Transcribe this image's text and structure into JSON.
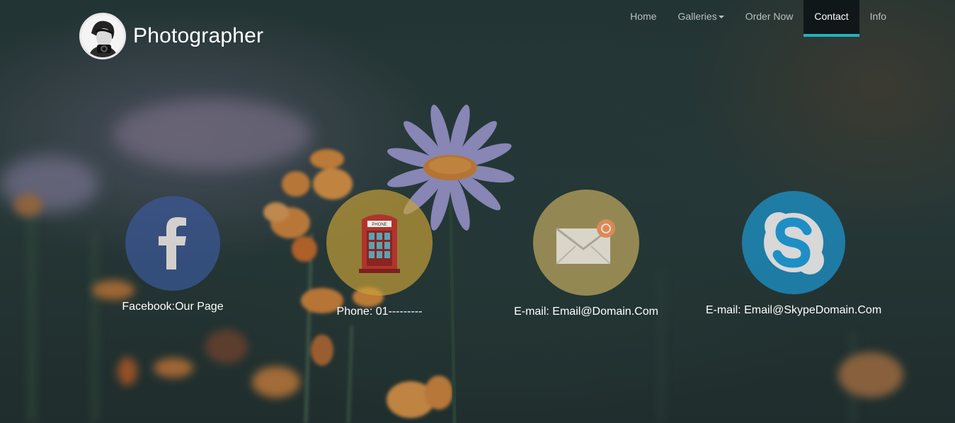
{
  "header": {
    "brand_title": "Photographer",
    "avatar_icon": "photographer-avatar"
  },
  "nav": {
    "items": [
      {
        "label": "Home",
        "active": false
      },
      {
        "label": "Galleries",
        "active": false,
        "has_dropdown": true
      },
      {
        "label": "Order Now",
        "active": false
      },
      {
        "label": "Contact",
        "active": true
      },
      {
        "label": "Info",
        "active": false
      }
    ],
    "accent_color": "#21b3c0"
  },
  "contacts": [
    {
      "icon": "facebook-icon",
      "label": "Facebook:Our Page",
      "color": "#3b5998"
    },
    {
      "icon": "phone-booth-icon",
      "label": "Phone: 01---------",
      "color": "#c9a13a"
    },
    {
      "icon": "mail-icon",
      "label": "E-mail: Email@Domain.Com",
      "color": "#c9b062"
    },
    {
      "icon": "skype-icon",
      "label": "E-mail: Email@SkypeDomain.Com",
      "color": "#1e8fc4"
    }
  ]
}
